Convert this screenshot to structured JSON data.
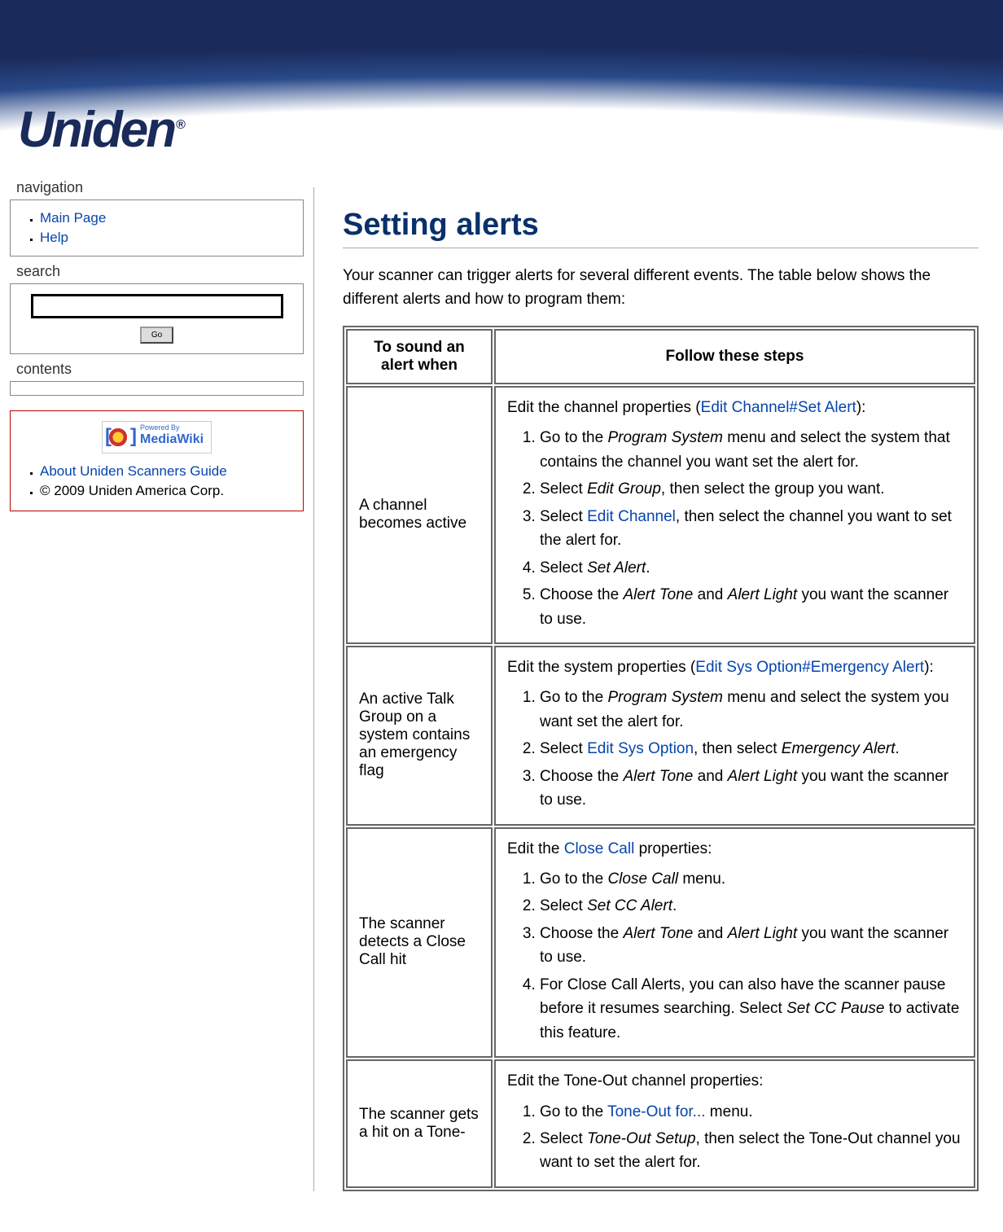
{
  "nav": {
    "heading_navigation": "navigation",
    "main_page": "Main Page",
    "help": "Help",
    "heading_search": "search",
    "go_button": "Go",
    "heading_contents": "contents",
    "about_link": "About Uniden Scanners Guide",
    "copyright": "© 2009 Uniden America Corp.",
    "mw_powered": "Powered By",
    "mw_name": "MediaWiki"
  },
  "logo_text": "Uniden",
  "logo_reg": "®",
  "page": {
    "title": "Setting alerts",
    "intro": "Your scanner can trigger alerts for several different events. The table below shows the different alerts and how to program them:"
  },
  "table": {
    "head_col1": "To sound an alert when",
    "head_col2": "Follow these steps",
    "rows": [
      {
        "condition": "A channel becomes active",
        "lead_a": "Edit the channel properties (",
        "lead_link": "Edit Channel#Set Alert",
        "lead_b": "):",
        "steps": [
          {
            "pre": "Go to the ",
            "em": "Program System",
            "post": " menu and select the system that contains the channel you want set the alert for."
          },
          {
            "pre": "Select ",
            "em": "Edit Group",
            "post": ", then select the group you want."
          },
          {
            "pre": "Select ",
            "link": "Edit Channel",
            "post": ", then select the channel you want to set the alert for."
          },
          {
            "pre": "Select ",
            "em": "Set Alert",
            "post": "."
          },
          {
            "pre": "Choose the ",
            "em": "Alert Tone",
            "mid": " and ",
            "em2": "Alert Light",
            "post": " you want the scanner to use."
          }
        ]
      },
      {
        "condition": "An active Talk Group on a system contains an emergency flag",
        "lead_a": "Edit the system properties (",
        "lead_link": "Edit Sys Option#Emergency Alert",
        "lead_b": "):",
        "steps": [
          {
            "pre": "Go to the ",
            "em": "Program System",
            "post": " menu and select the system you want set the alert for."
          },
          {
            "pre": "Select ",
            "link": "Edit Sys Option",
            "mid": ", then select ",
            "em2": "Emergency Alert",
            "post": "."
          },
          {
            "pre": "Choose the ",
            "em": "Alert Tone",
            "mid": " and ",
            "em2": "Alert Light",
            "post": " you want the scanner to use."
          }
        ]
      },
      {
        "condition": "The scanner detects a Close Call hit",
        "lead_a": "Edit the ",
        "lead_link": "Close Call",
        "lead_b": " properties:",
        "steps": [
          {
            "pre": "Go to the ",
            "em": "Close Call",
            "post": " menu."
          },
          {
            "pre": "Select ",
            "em": "Set CC Alert",
            "post": "."
          },
          {
            "pre": "Choose the ",
            "em": "Alert Tone",
            "mid": " and ",
            "em2": "Alert Light",
            "post": " you want the scanner to use."
          },
          {
            "pre": "For Close Call Alerts, you can also have the scanner pause before it resumes searching. Select ",
            "em": "Set CC Pause",
            "post": " to activate this feature."
          }
        ]
      },
      {
        "condition": "The scanner gets a hit on a Tone-",
        "lead_a": "Edit the Tone-Out channel properties:",
        "lead_link": "",
        "lead_b": "",
        "steps": [
          {
            "pre": "Go to the ",
            "link": "Tone-Out for...",
            "post": " menu."
          },
          {
            "pre": "Select ",
            "em": "Tone-Out Setup",
            "post": ", then select the Tone-Out channel you want to set the alert for."
          }
        ]
      }
    ]
  }
}
